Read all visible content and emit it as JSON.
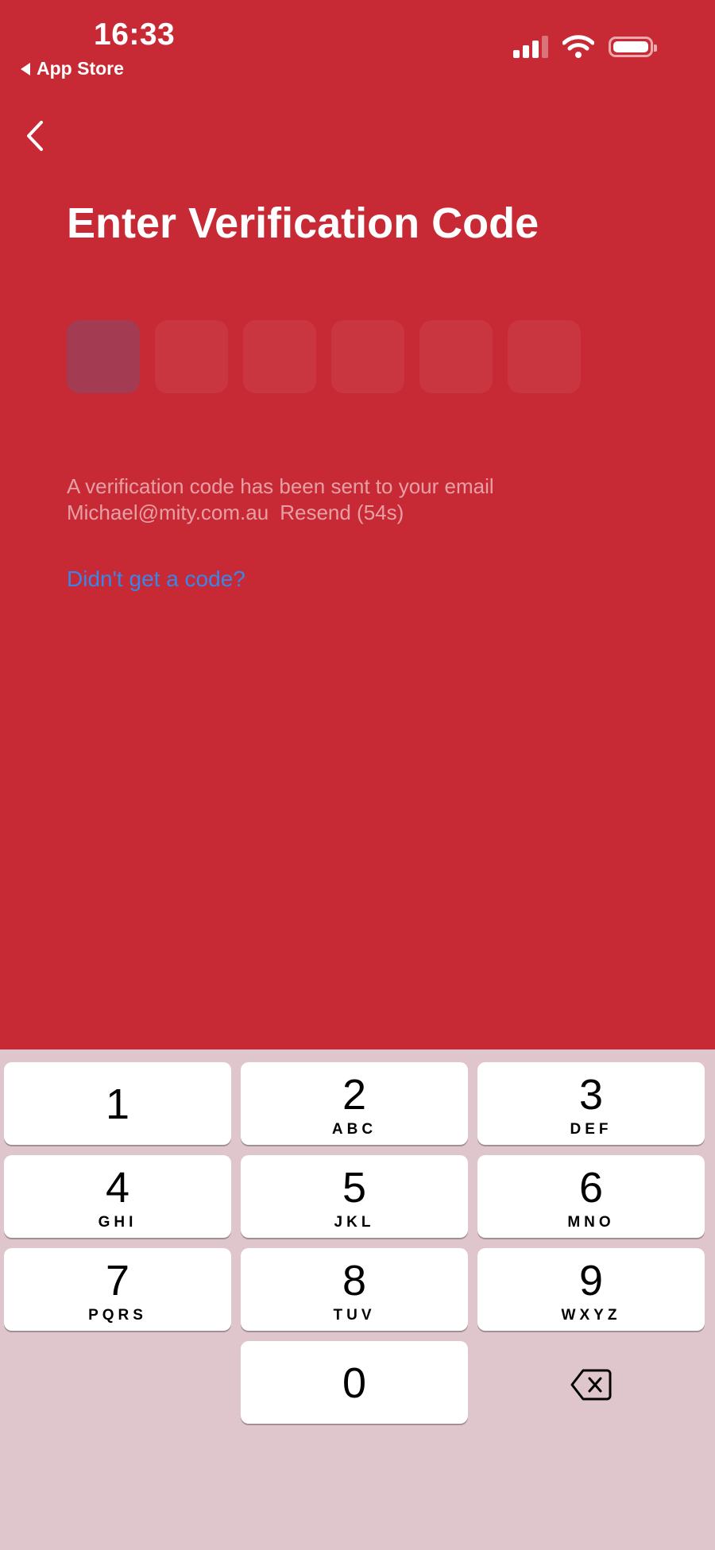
{
  "status_bar": {
    "time": "16:33",
    "back_app_label": "App Store",
    "signal_icon": "cellular-signal-icon",
    "wifi_icon": "wifi-icon",
    "battery_icon": "battery-icon"
  },
  "nav": {
    "back_icon": "chevron-left-icon"
  },
  "title": "Enter Verification Code",
  "code_input": {
    "length": 6,
    "active_index": 0
  },
  "info": {
    "line1": "A verification code has been sent to your email",
    "email": "Michael@mity.com.au",
    "resend": "Resend (54s)"
  },
  "help_link": "Didn't get a code?",
  "colors": {
    "background": "#c72a35",
    "link": "#3a86e8",
    "keypad_background": "#dfc6cd"
  },
  "keypad": {
    "keys": [
      {
        "digit": "1",
        "letters": ""
      },
      {
        "digit": "2",
        "letters": "ABC"
      },
      {
        "digit": "3",
        "letters": "DEF"
      },
      {
        "digit": "4",
        "letters": "GHI"
      },
      {
        "digit": "5",
        "letters": "JKL"
      },
      {
        "digit": "6",
        "letters": "MNO"
      },
      {
        "digit": "7",
        "letters": "PQRS"
      },
      {
        "digit": "8",
        "letters": "TUV"
      },
      {
        "digit": "9",
        "letters": "WXYZ"
      },
      {
        "digit": "0",
        "letters": ""
      }
    ],
    "delete_icon": "backspace-icon"
  }
}
